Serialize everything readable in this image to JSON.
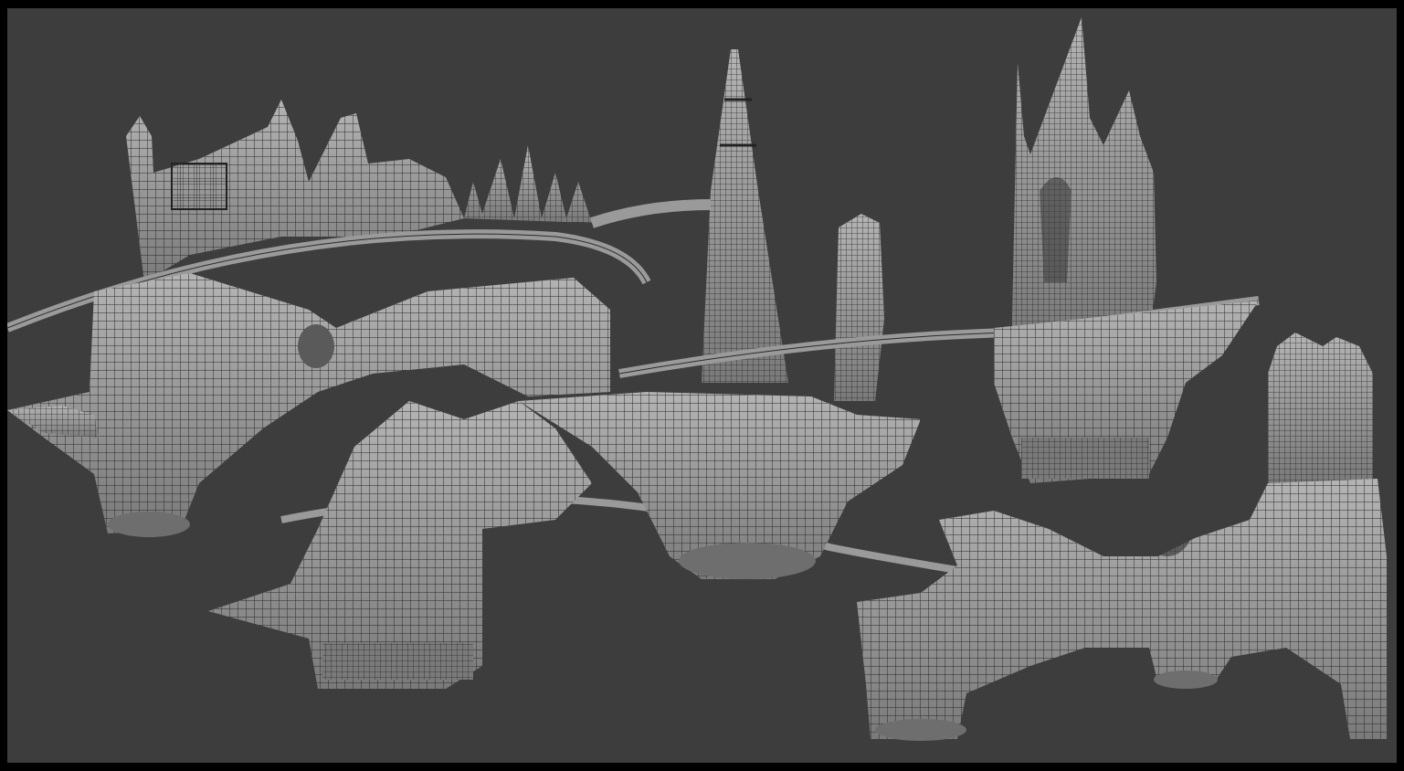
{
  "viewport": {
    "background_color": "#3d3d3d",
    "frame_color": "#000000",
    "mesh_fill_color": "#9a9a9a",
    "mesh_shade_color": "#6e6e6e",
    "wire_color": "#2a2a2a",
    "shading_mode_shown": "wireframe-on-shaded"
  }
}
